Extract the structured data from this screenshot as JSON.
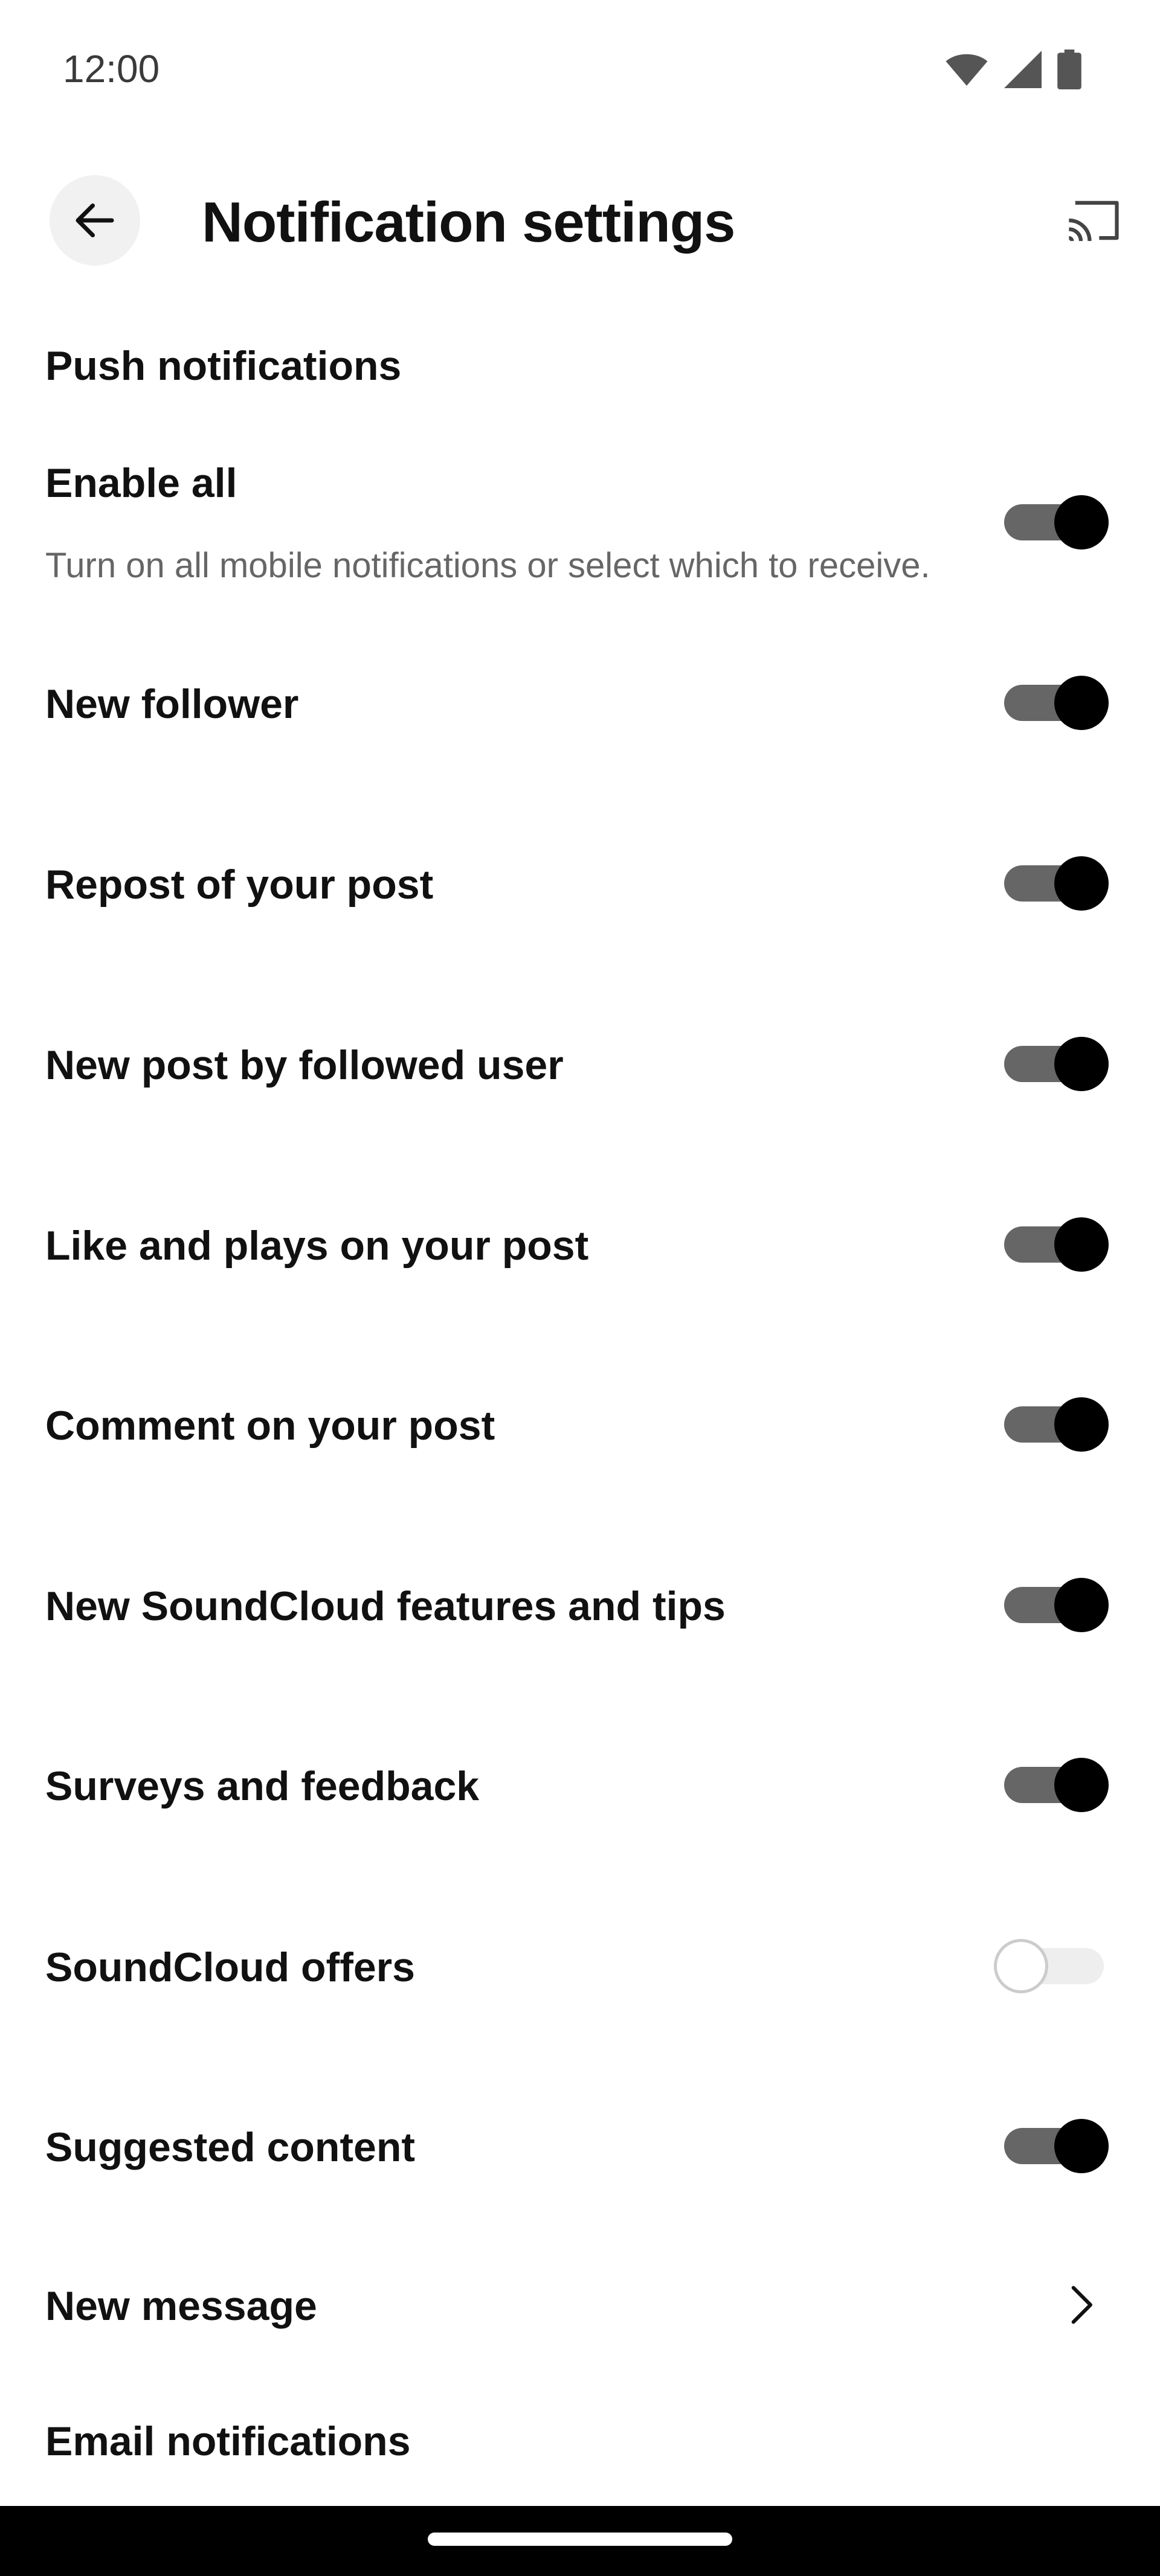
{
  "status_bar": {
    "time": "12:00",
    "icons": [
      "wifi-icon",
      "signal-icon",
      "battery-icon"
    ]
  },
  "app_bar": {
    "title": "Notification settings",
    "back_icon": "arrow-left-icon",
    "cast_icon": "cast-icon"
  },
  "push_section": {
    "header": "Push notifications",
    "enable_all": {
      "label": "Enable all",
      "description": "Turn on all mobile notifications or select which to receive.",
      "on": true
    },
    "items": [
      {
        "label": "New follower",
        "on": true
      },
      {
        "label": "Repost of your post",
        "on": true
      },
      {
        "label": "New post by followed user",
        "on": true
      },
      {
        "label": "Like and plays on your post",
        "on": true
      },
      {
        "label": "Comment on your post",
        "on": true
      },
      {
        "label": "New SoundCloud features and tips",
        "on": true
      },
      {
        "label": "Surveys and feedback",
        "on": true
      },
      {
        "label": "SoundCloud offers",
        "on": false
      },
      {
        "label": "Suggested content",
        "on": true
      }
    ],
    "new_message": {
      "label": "New message",
      "icon": "chevron-right-icon"
    }
  },
  "email_section": {
    "header": "Email notifications"
  },
  "colors": {
    "toggle_on_track": "#666666",
    "toggle_on_thumb": "#000000",
    "toggle_off_track": "#eeeeee",
    "toggle_off_thumb": "#ffffff",
    "text_primary": "#111111",
    "text_secondary": "#666666"
  }
}
